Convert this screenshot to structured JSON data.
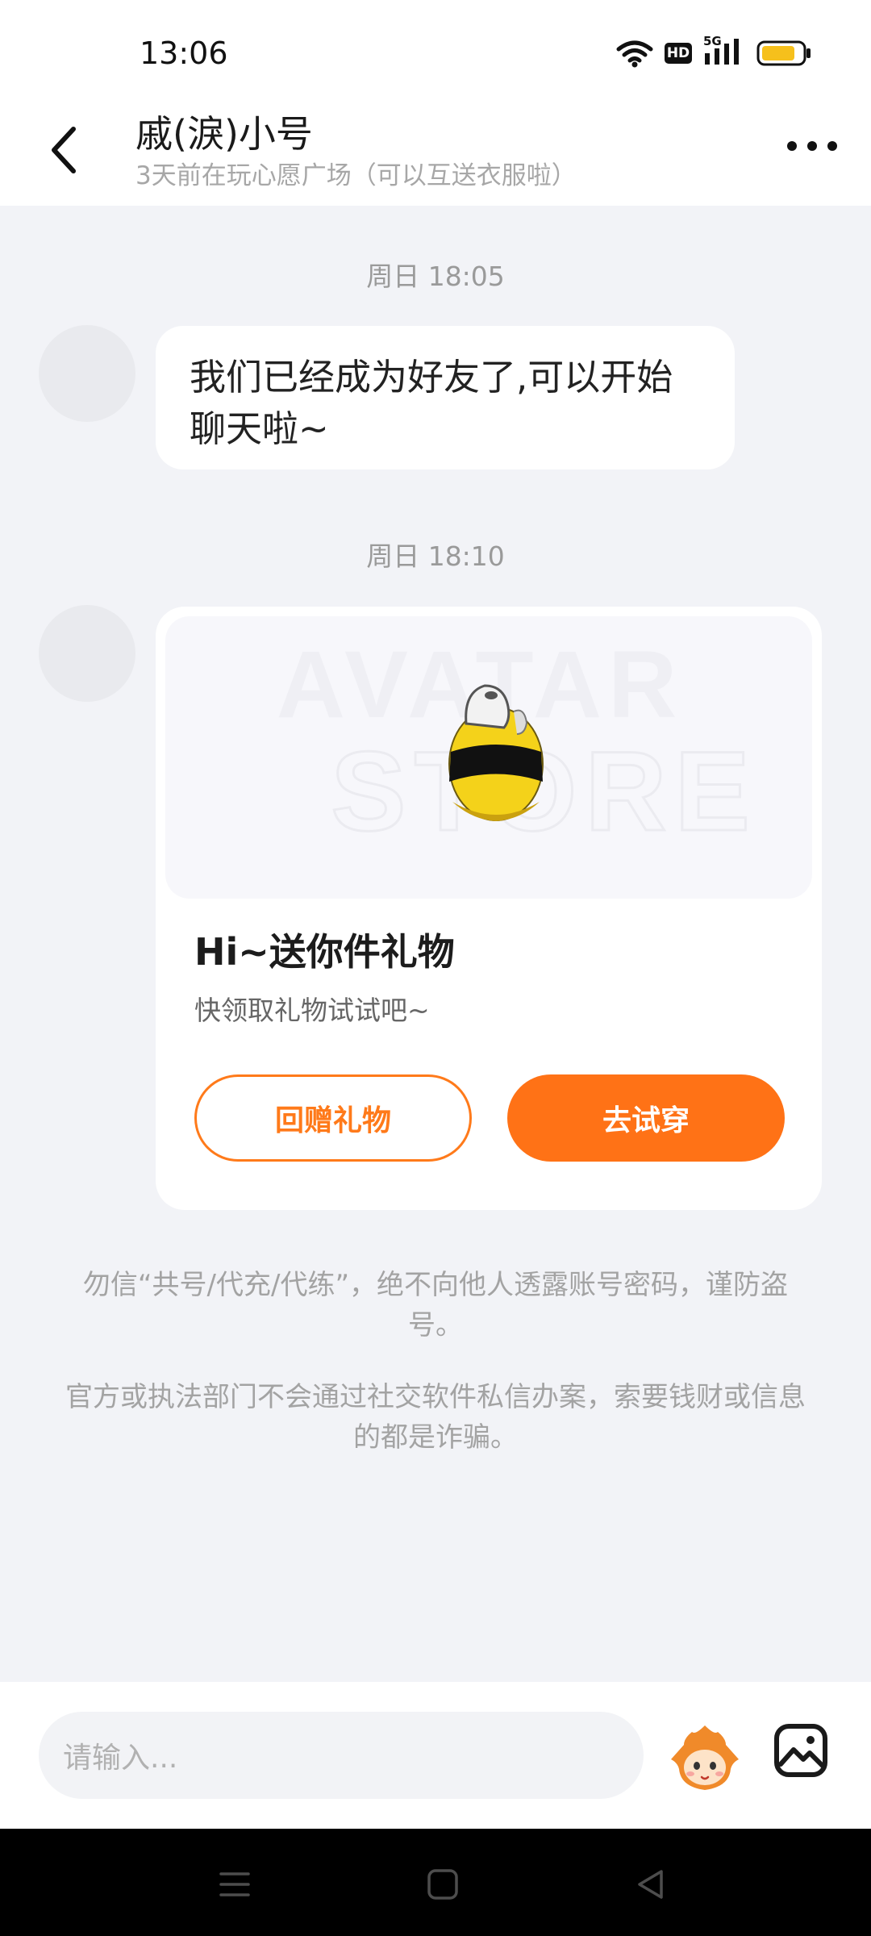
{
  "status_bar": {
    "time": "13:06",
    "network": "5G",
    "hd": "HD",
    "icons": [
      "wifi-icon",
      "hd-icon",
      "signal-icon",
      "battery-icon"
    ]
  },
  "header": {
    "back_icon": "chevron-left-icon",
    "title": "戚(淚)小号",
    "subtitle": "3天前在玩心愿广场（可以互送衣服啦）",
    "more_icon": "more-horizontal-icon"
  },
  "messages": [
    {
      "timestamp": "周日 18:05",
      "text": "我们已经成为好友了,可以开始聊天啦~"
    },
    {
      "timestamp": "周日 18:10",
      "gift_card": {
        "title": "Hi~送你件礼物",
        "description": "快领取礼物试试吧~",
        "return_gift_label": "回赠礼物",
        "try_on_label": "去试穿",
        "image_alt": "bee-costume-gift-image"
      }
    }
  ],
  "notices": [
    "勿信“共号/代充/代练”，绝不向他人透露账号密码，谨防盗号。",
    "官方或执法部门不会通过社交软件私信办案，索要钱财或信息的都是诈骗。"
  ],
  "input_bar": {
    "placeholder": "请输入...",
    "emoji_icon": "sticker-avatar-icon",
    "image_icon": "image-icon"
  },
  "colors": {
    "accent": "#ff7216",
    "background": "#f2f3f7",
    "timestamp": "#9a9a9a"
  },
  "nav_bar": {
    "icons": [
      "menu-icon",
      "home-square-icon",
      "back-triangle-icon"
    ]
  }
}
